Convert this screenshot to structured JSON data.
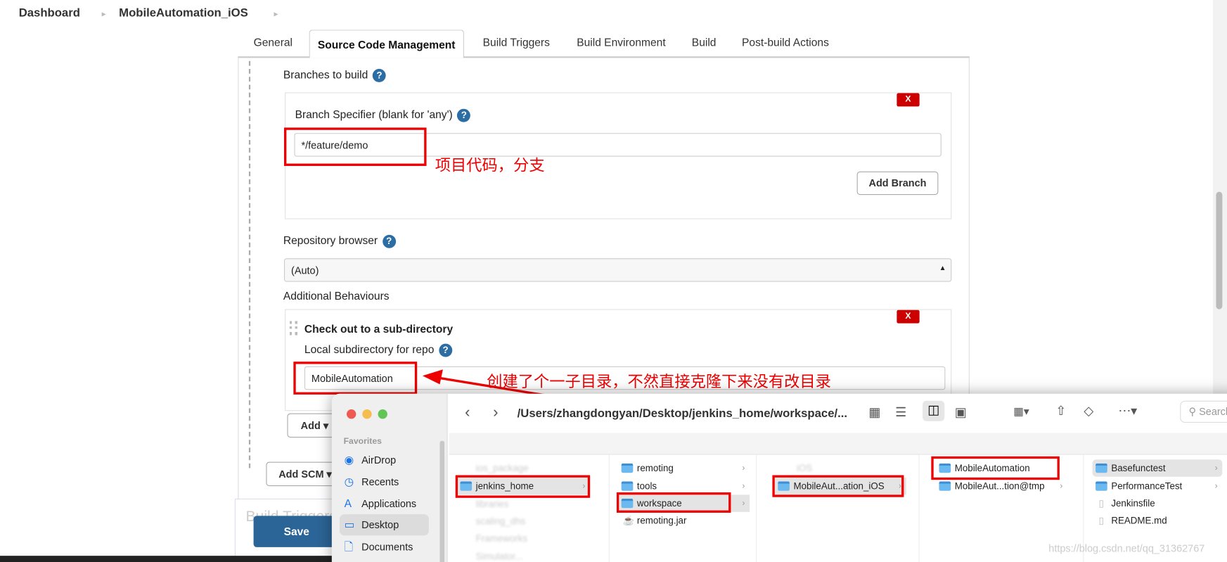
{
  "breadcrumb": [
    "Dashboard",
    "MobileAutomation_iOS"
  ],
  "tabs": [
    "General",
    "Source Code Management",
    "Build Triggers",
    "Build Environment",
    "Build",
    "Post-build Actions"
  ],
  "active_tab": "Source Code Management",
  "scm": {
    "branches_label": "Branches to build",
    "branch_specifier_label": "Branch Specifier (blank for 'any')",
    "branch_specifier_value": "*/feature/demo",
    "delete_label": "X",
    "add_branch": "Add Branch",
    "repo_browser_label": "Repository browser",
    "repo_browser_value": "(Auto)",
    "additional_behaviours": "Additional Behaviours",
    "checkout_title": "Check out to a sub-directory",
    "local_subdir_label": "Local subdirectory for repo",
    "local_subdir_value": "MobileAutomation",
    "add": "Add",
    "add_scm": "Add SCM"
  },
  "build_triggers_heading": "Build Triggers",
  "save": "Save",
  "annotations": {
    "branch": "项目代码，分支",
    "subdir": "创建了个一子目录，不然直接克隆下来没有改目录"
  },
  "annotation_color": "#e00000",
  "finder": {
    "path": "/Users/zhangdongyan/Desktop/jenkins_home/workspace/...",
    "search_placeholder": "Search",
    "favorites_label": "Favorites",
    "sidebar": [
      {
        "label": "AirDrop",
        "icon": "airdrop-icon"
      },
      {
        "label": "Recents",
        "icon": "clock-icon"
      },
      {
        "label": "Applications",
        "icon": "applications-icon"
      },
      {
        "label": "Desktop",
        "icon": "desktop-icon",
        "selected": true
      },
      {
        "label": "Documents",
        "icon": "document-icon"
      }
    ],
    "col1": [
      "jenkins_home"
    ],
    "col2": [
      "remoting",
      "tools",
      "workspace",
      "remoting.jar"
    ],
    "col3": [
      "MobileAut...ation_iOS"
    ],
    "col4": [
      "MobileAutomation",
      "MobileAut...tion@tmp"
    ],
    "col5": [
      "Basefunctest",
      "PerformanceTest",
      "Jenkinsfile",
      "README.md"
    ]
  },
  "watermark": "https://blog.csdn.net/qq_31362767"
}
